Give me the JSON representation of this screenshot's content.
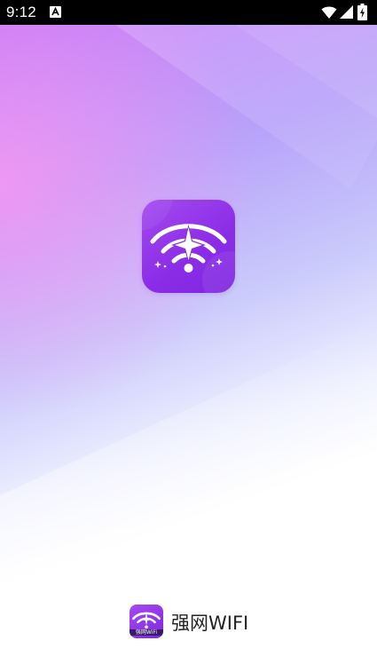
{
  "status_bar": {
    "time": "9:12",
    "icons": [
      "a-notification-icon",
      "wifi-icon",
      "signal-icon",
      "battery-charging-icon"
    ]
  },
  "splash": {
    "app_icon": "wifi-star-icon",
    "colors": {
      "icon_purple": "#8a2ce6",
      "gradient_pink": "#ff96f0",
      "gradient_lavender": "#b7a2fa"
    }
  },
  "brand": {
    "name": "强网WIFI",
    "icon_caption": "强网WiFi"
  }
}
